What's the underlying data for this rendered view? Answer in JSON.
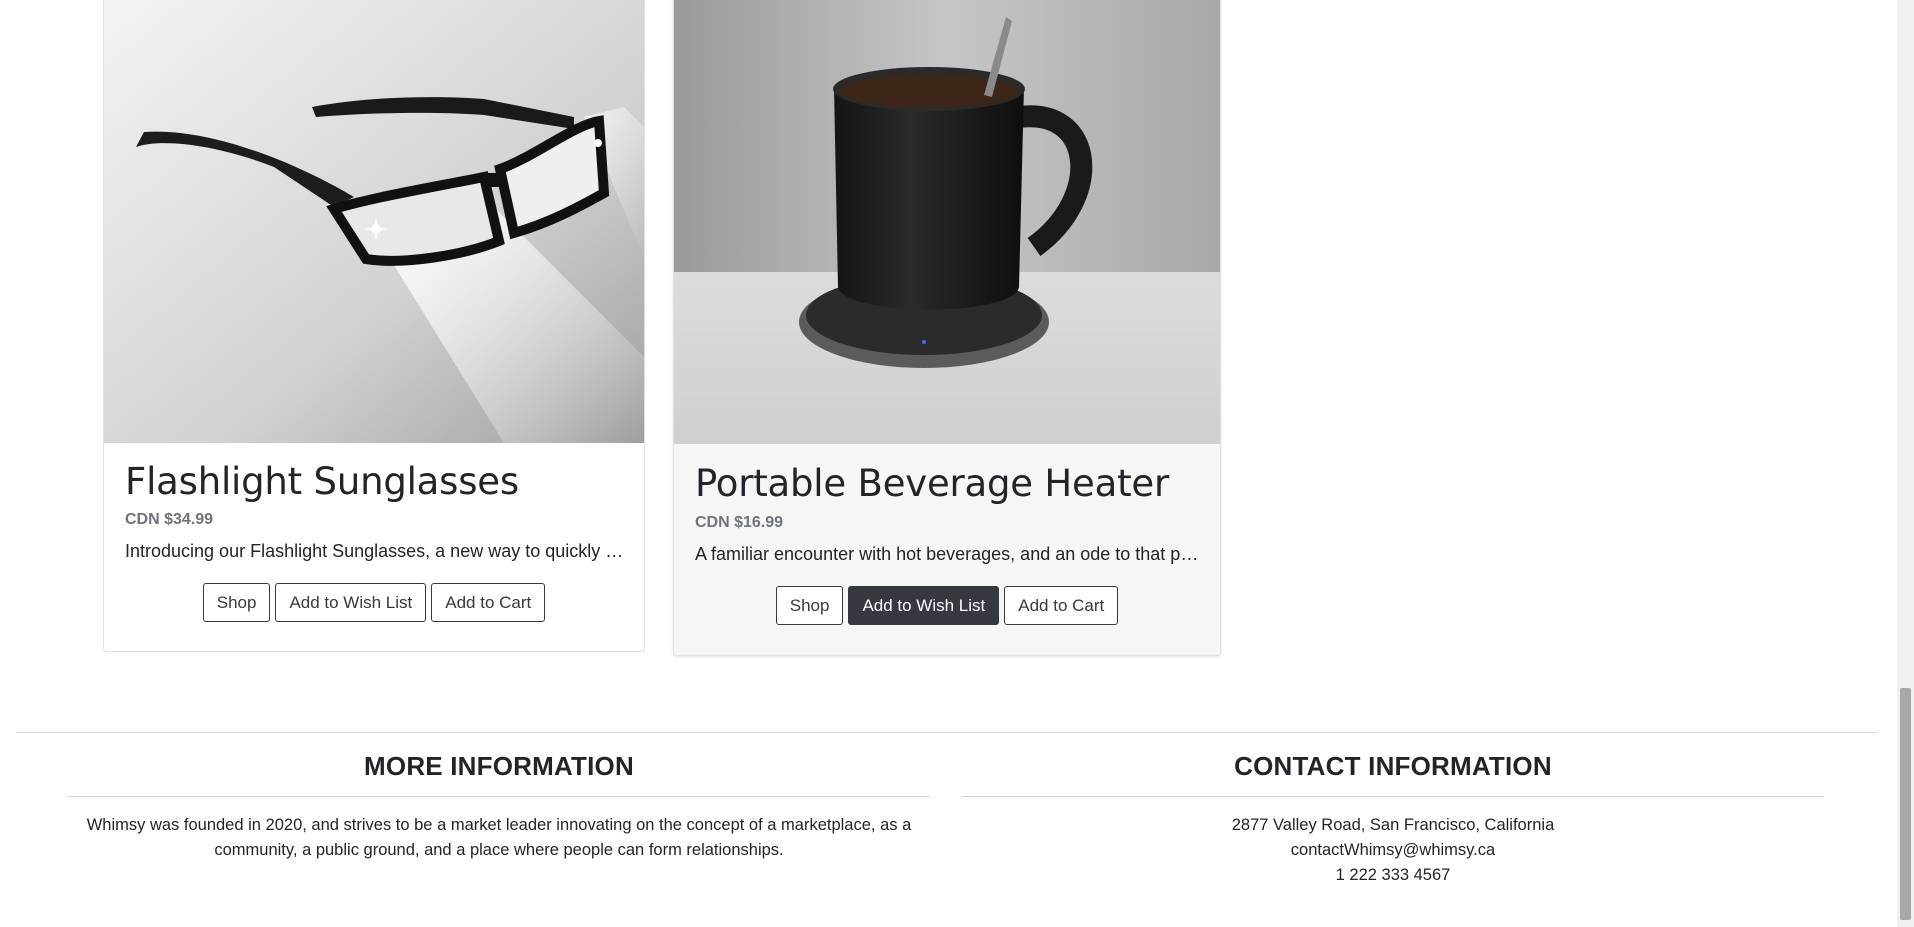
{
  "products": [
    {
      "title": "Flashlight Sunglasses",
      "price": "CDN $34.99",
      "description": "Introducing our Flashlight Sunglasses, a new way to quickly light up your surroundings",
      "buttons": {
        "shop": "Shop",
        "wishlist": "Add to Wish List",
        "cart": "Add to Cart"
      }
    },
    {
      "title": "Portable Beverage Heater",
      "price": "CDN $16.99",
      "description": "A familiar encounter with hot beverages, and an ode to that perfect temperature",
      "buttons": {
        "shop": "Shop",
        "wishlist": "Add to Wish List",
        "cart": "Add to Cart"
      }
    }
  ],
  "footer": {
    "more_info": {
      "heading": "MORE INFORMATION",
      "text_line1": "Whimsy was founded in 2020, and strives to be a market leader innovating on the concept of a marketplace, as a",
      "text_line2": "community, a public ground, and a place where people can form relationships."
    },
    "contact": {
      "heading": "CONTACT INFORMATION",
      "address": "2877 Valley Road, San Francisco, California",
      "email": "contactWhimsy@whimsy.ca",
      "phone": "1 222 333 4567"
    }
  },
  "colors": {
    "dark_button": "#343a40",
    "muted_text": "#6c757d",
    "border": "#dee2e6"
  }
}
